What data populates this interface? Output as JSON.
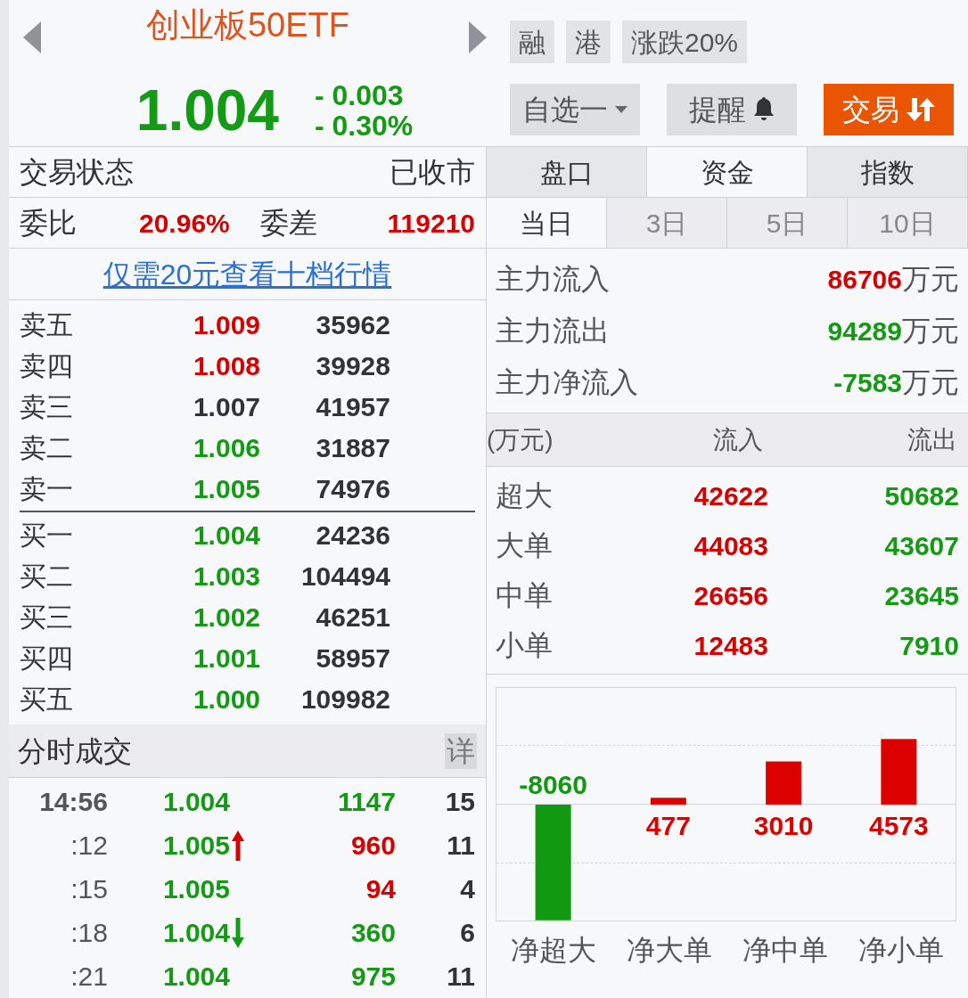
{
  "header": {
    "title": "创业板50ETF",
    "price": "1.004",
    "change": "- 0.003",
    "change_pct": "- 0.30%",
    "color": "#149a14",
    "tags": [
      "融",
      "港",
      "涨跌20%"
    ],
    "buttons": [
      {
        "label": "自选一",
        "kind": "dropdown"
      },
      {
        "label": "提醒",
        "kind": "alert"
      },
      {
        "label": "交易",
        "kind": "trade"
      }
    ]
  },
  "status": {
    "label": "交易状态",
    "value": "已收市"
  },
  "ratio": {
    "label": "委比",
    "value": "20.96%",
    "diff_label": "委差",
    "diff_value": "119210"
  },
  "promo_link": "仅需20元查看十档行情",
  "order_book": {
    "asks": [
      {
        "label": "卖五",
        "price": "1.009",
        "volume": "35962",
        "color": "#d60000"
      },
      {
        "label": "卖四",
        "price": "1.008",
        "volume": "39928",
        "color": "#d60000"
      },
      {
        "label": "卖三",
        "price": "1.007",
        "volume": "41957",
        "color": "#333333"
      },
      {
        "label": "卖二",
        "price": "1.006",
        "volume": "31887",
        "color": "#149a14"
      },
      {
        "label": "卖一",
        "price": "1.005",
        "volume": "74976",
        "color": "#149a14"
      }
    ],
    "bids": [
      {
        "label": "买一",
        "price": "1.004",
        "volume": "24236",
        "color": "#149a14"
      },
      {
        "label": "买二",
        "price": "1.003",
        "volume": "104494",
        "color": "#149a14"
      },
      {
        "label": "买三",
        "price": "1.002",
        "volume": "46251",
        "color": "#149a14"
      },
      {
        "label": "买四",
        "price": "1.001",
        "volume": "58957",
        "color": "#149a14"
      },
      {
        "label": "买五",
        "price": "1.000",
        "volume": "109982",
        "color": "#149a14"
      }
    ]
  },
  "trades": {
    "title": "分时成交",
    "detail_button": "详",
    "rows": [
      {
        "time": "14:56",
        "price": "1.004",
        "up_arrow": false,
        "down_arrow": false,
        "volume": "1147",
        "color": "#149a14",
        "count": "15"
      },
      {
        "time": ":12",
        "price": "1.005",
        "up_arrow": true,
        "down_arrow": false,
        "volume": "960",
        "color": "#d60000",
        "count": "11"
      },
      {
        "time": ":15",
        "price": "1.005",
        "up_arrow": false,
        "down_arrow": false,
        "volume": "94",
        "color": "#d60000",
        "count": "4"
      },
      {
        "time": ":18",
        "price": "1.004",
        "up_arrow": false,
        "down_arrow": true,
        "volume": "360",
        "color": "#149a14",
        "count": "6"
      },
      {
        "time": ":21",
        "price": "1.004",
        "up_arrow": false,
        "down_arrow": false,
        "volume": "975",
        "color": "#149a14",
        "count": "11"
      }
    ]
  },
  "tabs": [
    {
      "label": "盘口",
      "selected": false
    },
    {
      "label": "资金",
      "selected": true
    },
    {
      "label": "指数",
      "selected": false
    }
  ],
  "period_tabs": [
    {
      "label": "当日",
      "selected": true
    },
    {
      "label": "3日",
      "selected": false
    },
    {
      "label": "5日",
      "selected": false
    },
    {
      "label": "10日",
      "selected": false
    }
  ],
  "main_flow": [
    {
      "label": "主力流入",
      "value": "86706",
      "unit": "万元",
      "color": "#d60000"
    },
    {
      "label": "主力流出",
      "value": "94289",
      "unit": "万元",
      "color": "#149a14"
    },
    {
      "label": "主力净流入",
      "value": "-7583",
      "unit": "万元",
      "color": "#149a14"
    }
  ],
  "flow_table": {
    "columns": [
      "(万元)",
      "流入",
      "流出"
    ],
    "rows": [
      {
        "label": "超大",
        "inflow": "42622",
        "outflow": "50682"
      },
      {
        "label": "大单",
        "inflow": "44083",
        "outflow": "43607"
      },
      {
        "label": "中单",
        "inflow": "26656",
        "outflow": "23645"
      },
      {
        "label": "小单",
        "inflow": "12483",
        "outflow": "7910"
      }
    ]
  },
  "net_chart": {
    "chart_data": {
      "type": "bar",
      "categories": [
        "净超大",
        "净大单",
        "净中单",
        "净小单"
      ],
      "series": [
        {
          "color": "#dd0000",
          "values": [
            null,
            477,
            3010,
            4573
          ]
        },
        {
          "color": "#119911",
          "values": [
            -8060,
            null,
            null,
            null
          ]
        }
      ],
      "data_labels": true
    }
  }
}
